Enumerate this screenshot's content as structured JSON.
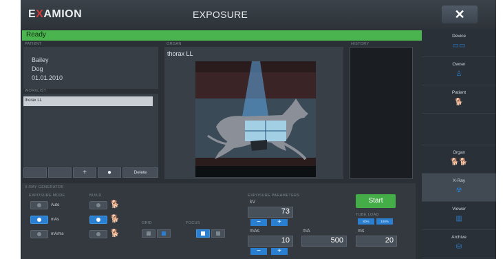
{
  "app": {
    "logo_prefix": "E",
    "logo_x": "X",
    "logo_suffix": "AMION",
    "title": "EXPOSURE",
    "close_glyph": "✕"
  },
  "status": {
    "text": "Ready",
    "color": "#4ab54e"
  },
  "patient": {
    "section_label": "PATIENT",
    "name": "Bailey",
    "species": "Dog",
    "date": "01.01.2010"
  },
  "worklist": {
    "section_label": "WORKLIST",
    "items": [
      "thorax LL"
    ],
    "buttons": {
      "add": "+",
      "dot": "●",
      "delete": "Delete"
    }
  },
  "organ": {
    "section_label": "ORGAN",
    "name": "thorax LL"
  },
  "history": {
    "section_label": "HISTORY"
  },
  "xray": {
    "section_label": "X-RAY GENERATOR",
    "exposure_mode_label": "EXPOSURE MODE",
    "build_label": "BUILD",
    "grid_label": "GRID",
    "focus_label": "FOCUS",
    "modes": [
      {
        "label": "Auto",
        "selected": false
      },
      {
        "label": "mAs",
        "selected": true
      },
      {
        "label": "mA/ms",
        "selected": false
      }
    ],
    "build": [
      {
        "selected": false,
        "icon": "dog-small-icon"
      },
      {
        "selected": true,
        "icon": "dog-medium-icon"
      },
      {
        "selected": false,
        "icon": "dog-large-icon"
      }
    ],
    "grid": [
      {
        "selected": false
      },
      {
        "selected": false
      }
    ],
    "focus": [
      {
        "selected": true
      },
      {
        "selected": false
      }
    ]
  },
  "params": {
    "section_label": "EXPOSURE PARAMETERS",
    "kv_label": "kV",
    "kv": "73",
    "mas_label": "mAs",
    "mas": "10",
    "ma_label": "mA",
    "ma": "500",
    "ms_label": "ms",
    "ms": "20",
    "minus": "−",
    "plus": "+"
  },
  "start": {
    "label": "Start"
  },
  "tube_load": {
    "label": "TUBE LOAD",
    "opt1": "80%",
    "opt2": "100%"
  },
  "sidebar": {
    "items": [
      {
        "label": "Device",
        "icon": "device-icon",
        "glyph": "▭▭",
        "active": false
      },
      {
        "label": "Owner",
        "icon": "owner-icon",
        "glyph": "♙",
        "active": false
      },
      {
        "label": "Patient",
        "icon": "patient-dog-icon",
        "glyph": "🐕",
        "active": false
      },
      {
        "label": "",
        "icon": "",
        "glyph": "",
        "active": false
      },
      {
        "label": "Organ",
        "icon": "organ-icon",
        "glyph": "🐕🐕",
        "active": false
      },
      {
        "label": "X-Ray",
        "icon": "xray-icon",
        "glyph": "☢",
        "active": true
      },
      {
        "label": "Viewer",
        "icon": "viewer-icon",
        "glyph": "▥",
        "active": false
      },
      {
        "label": "Archive",
        "icon": "archive-icon",
        "glyph": "⛁",
        "active": false
      }
    ]
  },
  "colors": {
    "accent": "#2a7fd0",
    "ok": "#44ad48",
    "panel": "#383e45",
    "bg": "#2b3036"
  }
}
